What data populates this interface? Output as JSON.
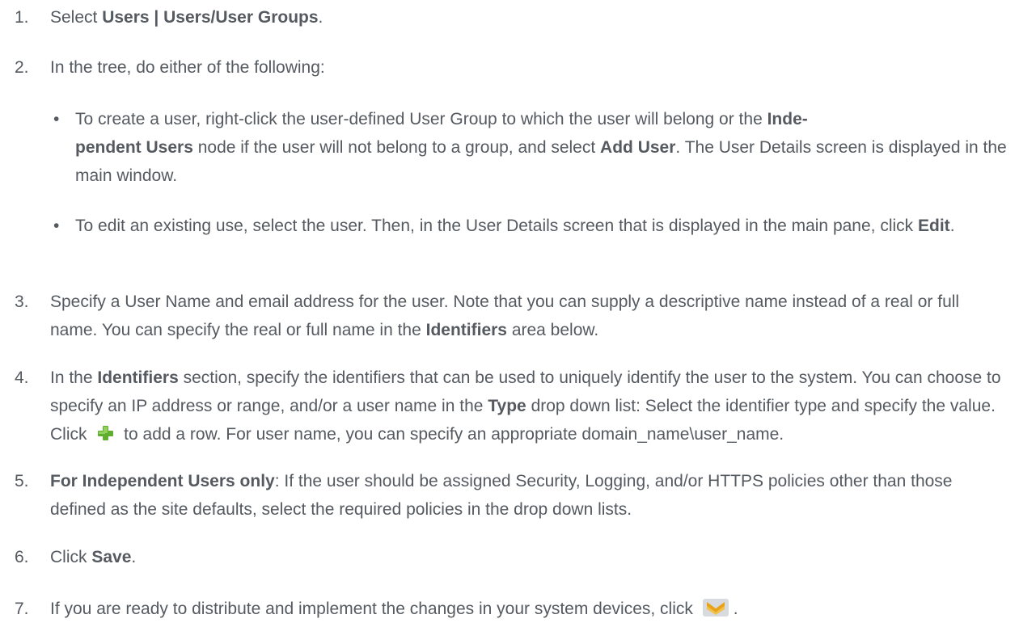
{
  "steps": [
    {
      "num": "1.",
      "parts": [
        {
          "t": "Select "
        },
        {
          "b": "Users | Users/User Groups"
        },
        {
          "t": "."
        }
      ]
    },
    {
      "num": "2.",
      "parts": [
        {
          "t": "In the tree, do either of the following:"
        }
      ]
    },
    {
      "num": "3.",
      "parts": [
        {
          "t": "Specify a User Name and email address for the user. Note that you can supply a descriptive name instead of a real or full name. You can specify the real or full name in the "
        },
        {
          "b": "Identifiers"
        },
        {
          "t": " area below."
        }
      ]
    },
    {
      "num": "4.",
      "parts": [
        {
          "t": "In the "
        },
        {
          "b": "Identifiers"
        },
        {
          "t": " section, specify the identifiers that can be used to uniquely identify the user to the system. You can choose to specify an IP address or range, and/or a user name in the "
        },
        {
          "b": "Type"
        },
        {
          "t": " drop down list: Select the identifier type and specify the value. Click "
        },
        {
          "icon": "add-row-icon"
        },
        {
          "t": " to add a row. For user name, you can specify an appropriate domain_name\\user_name."
        }
      ]
    },
    {
      "num": "5.",
      "parts": [
        {
          "b": "For Independent Users only"
        },
        {
          "t": ": If the user should be assigned Security, Logging, and/or HTTPS policies other than those defined as the site defaults, select the required policies in the drop down lists."
        }
      ]
    },
    {
      "num": "6.",
      "parts": [
        {
          "t": "Click "
        },
        {
          "b": "Save"
        },
        {
          "t": "."
        }
      ]
    },
    {
      "num": "7.",
      "parts": [
        {
          "t": "If you are ready to distribute and implement the changes in your system devices, click "
        },
        {
          "icon": "distribute-icon"
        },
        {
          "t": "."
        }
      ]
    }
  ],
  "bullets": [
    {
      "marker": "•",
      "parts": [
        {
          "t": "To create a user, right-click the user-defined User Group to which the user will belong or the "
        },
        {
          "b": "Inde-pendent Users"
        },
        {
          "t": " node if the user will not belong to a group, and select "
        },
        {
          "b": "Add User"
        },
        {
          "t": ". The User Details screen is displayed in the main window."
        }
      ]
    },
    {
      "marker": "•",
      "parts": [
        {
          "t": "To edit an existing use, select the user. Then, in the User Details screen that is displayed in the main pane, click "
        },
        {
          "b": "Edit"
        },
        {
          "t": "."
        }
      ]
    }
  ],
  "colors": {
    "text": "#555a60",
    "add_icon": "#5fae2e",
    "distribute_icon": "#e8a317"
  }
}
